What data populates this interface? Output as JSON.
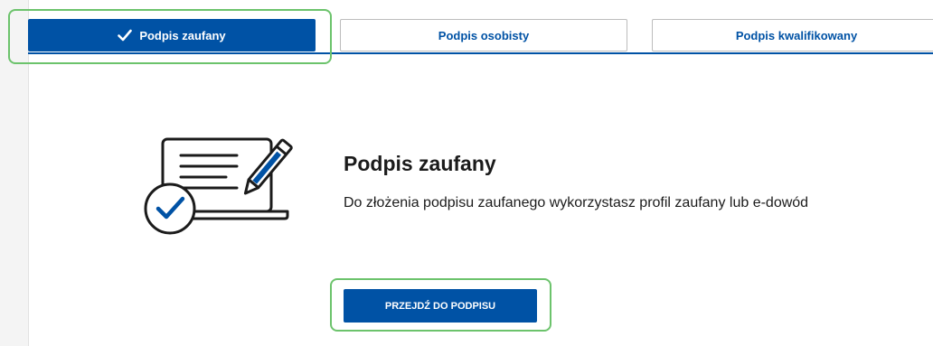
{
  "tabs": [
    {
      "label": "Podpis zaufany",
      "active": true,
      "icon": "check-icon"
    },
    {
      "label": "Podpis osobisty",
      "active": false
    },
    {
      "label": "Podpis kwalifikowany",
      "active": false
    }
  ],
  "content": {
    "title": "Podpis zaufany",
    "description": "Do złożenia podpisu zaufanego wykorzystasz profil zaufany lub e-dowód",
    "illustration_icon": "laptop-pen-checkmark-icon",
    "button_label": "PRZEJDŹ DO PODPISU"
  },
  "colors": {
    "primary": "#0052a5",
    "highlight": "#6cc36c",
    "text": "#1b1b1b"
  }
}
